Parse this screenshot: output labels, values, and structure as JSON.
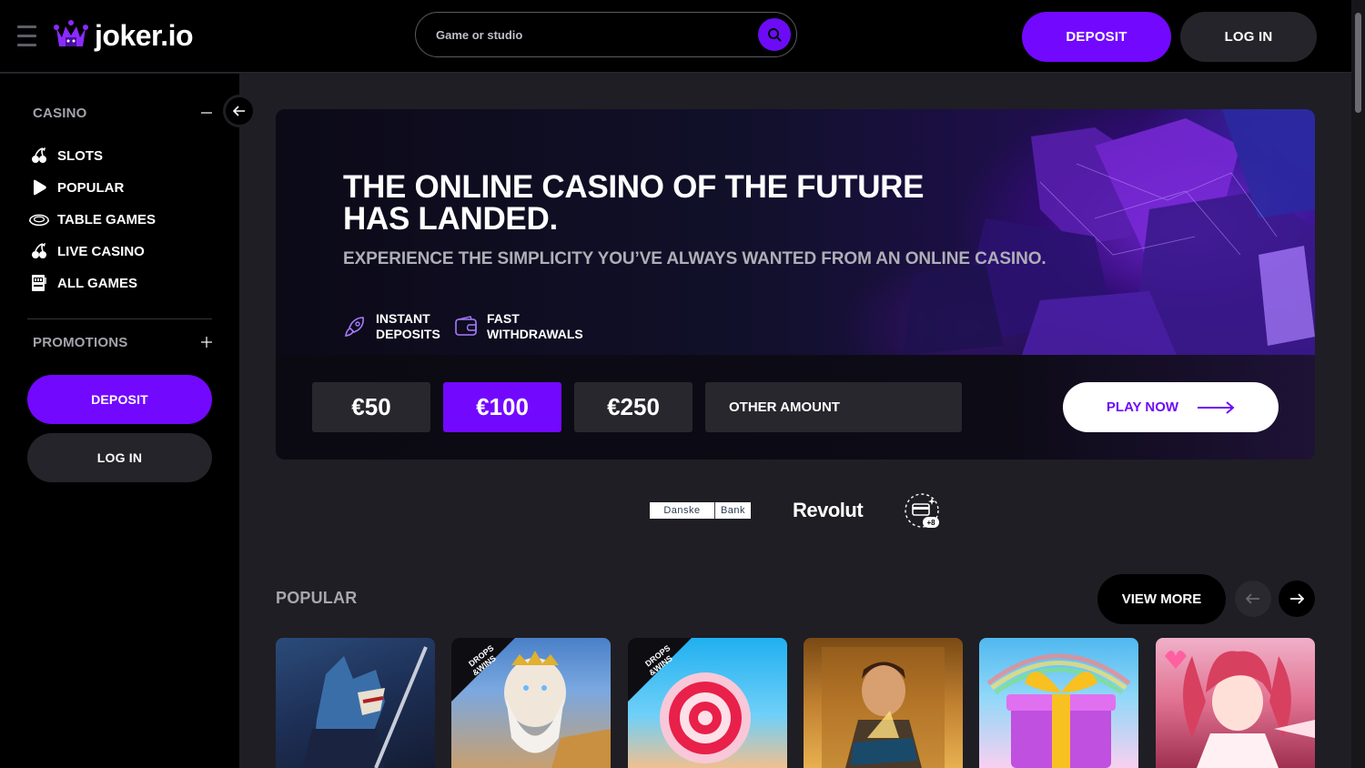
{
  "header": {
    "logo_text": "joker.io",
    "search_placeholder": "Game or studio",
    "deposit_label": "DEPOSIT",
    "login_label": "LOG IN"
  },
  "sidebar": {
    "casino_heading": "CASINO",
    "items": [
      {
        "label": "SLOTS",
        "icon": "cherries-icon"
      },
      {
        "label": "POPULAR",
        "icon": "play-icon"
      },
      {
        "label": "TABLE GAMES",
        "icon": "roulette-icon"
      },
      {
        "label": "LIVE CASINO",
        "icon": "cherries-icon"
      },
      {
        "label": "ALL GAMES",
        "icon": "slot-machine-icon"
      }
    ],
    "promotions_heading": "PROMOTIONS",
    "deposit_label": "DEPOSIT",
    "login_label": "LOG IN"
  },
  "hero": {
    "title": "THE ONLINE CASINO OF THE FUTURE HAS LANDED.",
    "subtitle": "EXPERIENCE THE SIMPLICITY YOU’VE ALWAYS WANTED FROM AN ONLINE CASINO.",
    "features": [
      {
        "line1": "INSTANT",
        "line2": "DEPOSITS",
        "icon": "rocket-icon"
      },
      {
        "line1": "FAST",
        "line2": "WITHDRAWALS",
        "icon": "wallet-icon"
      }
    ],
    "amounts": [
      "€50",
      "€100",
      "€250"
    ],
    "selected_amount": "€100",
    "other_amount_label": "OTHER AMOUNT",
    "play_now_label": "PLAY NOW"
  },
  "payments": {
    "danske_part1": "Danske",
    "danske_part2": "Bank",
    "revolut": "Revolut",
    "more_count": "+8"
  },
  "popular": {
    "title": "POPULAR",
    "view_more_label": "VIEW MORE",
    "badge_line1": "DROPS",
    "badge_line2": "&WINS"
  },
  "colors": {
    "accent": "#7308ff",
    "background": "#1f1e24",
    "sidebar": "#000000"
  }
}
